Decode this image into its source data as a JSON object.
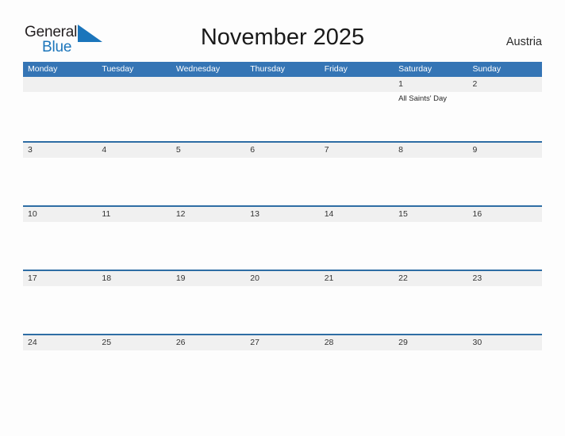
{
  "branding": {
    "logo_text_primary": "General",
    "logo_text_secondary": "Blue",
    "logo_flag_icon": "blue-flag-triangle-icon",
    "primary_color": "#1b75bb"
  },
  "header": {
    "title": "November 2025",
    "region": "Austria",
    "header_bg_color": "#3575b5",
    "rule_color": "#2e6da4",
    "date_strip_color": "#f0f0f0"
  },
  "calendar": {
    "weekdays": [
      "Monday",
      "Tuesday",
      "Wednesday",
      "Thursday",
      "Friday",
      "Saturday",
      "Sunday"
    ],
    "weeks": [
      {
        "days": [
          {
            "num": "",
            "events": []
          },
          {
            "num": "",
            "events": []
          },
          {
            "num": "",
            "events": []
          },
          {
            "num": "",
            "events": []
          },
          {
            "num": "",
            "events": []
          },
          {
            "num": "1",
            "events": [
              "All Saints' Day"
            ]
          },
          {
            "num": "2",
            "events": []
          }
        ]
      },
      {
        "days": [
          {
            "num": "3",
            "events": []
          },
          {
            "num": "4",
            "events": []
          },
          {
            "num": "5",
            "events": []
          },
          {
            "num": "6",
            "events": []
          },
          {
            "num": "7",
            "events": []
          },
          {
            "num": "8",
            "events": []
          },
          {
            "num": "9",
            "events": []
          }
        ]
      },
      {
        "days": [
          {
            "num": "10",
            "events": []
          },
          {
            "num": "11",
            "events": []
          },
          {
            "num": "12",
            "events": []
          },
          {
            "num": "13",
            "events": []
          },
          {
            "num": "14",
            "events": []
          },
          {
            "num": "15",
            "events": []
          },
          {
            "num": "16",
            "events": []
          }
        ]
      },
      {
        "days": [
          {
            "num": "17",
            "events": []
          },
          {
            "num": "18",
            "events": []
          },
          {
            "num": "19",
            "events": []
          },
          {
            "num": "20",
            "events": []
          },
          {
            "num": "21",
            "events": []
          },
          {
            "num": "22",
            "events": []
          },
          {
            "num": "23",
            "events": []
          }
        ]
      },
      {
        "days": [
          {
            "num": "24",
            "events": []
          },
          {
            "num": "25",
            "events": []
          },
          {
            "num": "26",
            "events": []
          },
          {
            "num": "27",
            "events": []
          },
          {
            "num": "28",
            "events": []
          },
          {
            "num": "29",
            "events": []
          },
          {
            "num": "30",
            "events": []
          }
        ]
      }
    ]
  }
}
